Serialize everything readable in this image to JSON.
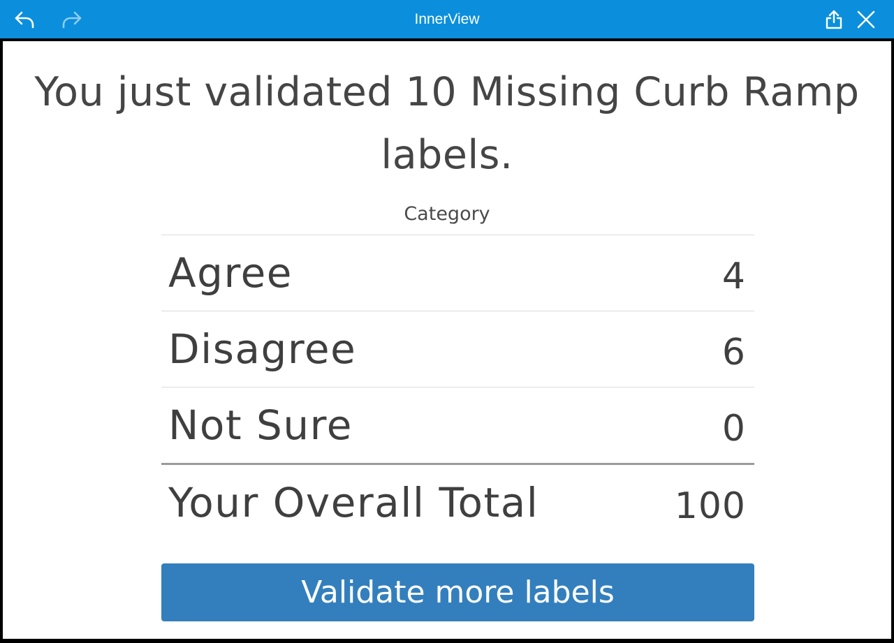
{
  "app": {
    "title": "InnerView"
  },
  "headline": "You just validated 10 Missing Curb Ramp labels.",
  "table": {
    "header": "Category",
    "rows": [
      {
        "label": "Agree",
        "value": "4"
      },
      {
        "label": "Disagree",
        "value": "6"
      },
      {
        "label": "Not Sure",
        "value": "0"
      }
    ],
    "total": {
      "label": "Your Overall Total",
      "value": "100"
    }
  },
  "button": {
    "label": "Validate more labels"
  },
  "colors": {
    "topbar": "#0b8fdc",
    "button": "#337fbd",
    "text": "#454545"
  },
  "icons": {
    "back": "undo-arrow-icon",
    "forward": "redo-arrow-icon",
    "share": "share-icon",
    "close": "close-icon"
  }
}
